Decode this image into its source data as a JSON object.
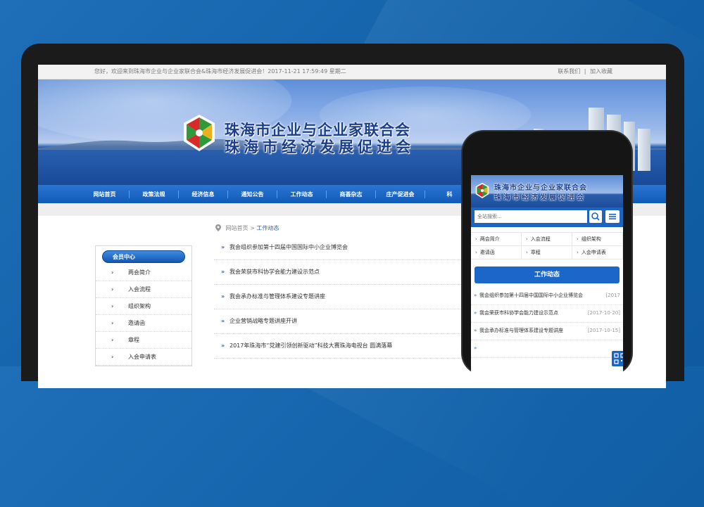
{
  "topbar": {
    "welcome": "您好，欢迎来到珠海市企业与企业家联合会&珠海市经济发展促进会！2017-11-21 17:59:49 星期二",
    "contact": "联系我们",
    "sep": "|",
    "favorite": "加入收藏"
  },
  "banner": {
    "title_line1": "珠海市企业与企业家联合会",
    "title_line2": "珠海市经济发展促进会"
  },
  "nav": [
    "网站首页",
    "政策法规",
    "经济信息",
    "通知公告",
    "工作动态",
    "商荟杂志",
    "庄产促进会",
    "科"
  ],
  "breadcrumb": {
    "home": "网站首页",
    "arrow": " > ",
    "current": "工作动态"
  },
  "sidebar": {
    "head": "会员中心",
    "items": [
      "两会简介",
      "入会流程",
      "组织架构",
      "邀请函",
      "章程",
      "入会申请表"
    ]
  },
  "news": [
    "我会组织参加第十四届中国国际中小企业博览会",
    "我会荣获市科协学会能力建设示范点",
    "我会承办标准与管理体系建设专题讲座",
    "企业营销战略专题讲座开讲",
    "2017年珠海市“党建引领创新驱动”科技大赛珠海电视台 圆满落幕"
  ],
  "phone": {
    "title_line1": "珠海市企业与企业家联合会",
    "title_line2": "珠海市经济发展促进会",
    "search_placeholder": "全站搜索...",
    "grid": [
      "两会简介",
      "入会流程",
      "组织架构",
      "邀请函",
      "章程",
      "入会申请表"
    ],
    "section_title": "工作动态",
    "news": [
      {
        "title": "我会组织参加第十四届中国国际中小企业博览会",
        "date": "[2017"
      },
      {
        "title": "我会荣获市科协学会能力建设示范点",
        "date": "[2017-10-20]"
      },
      {
        "title": "我会承办标准与管理体系建设专题讲座",
        "date": "[2017-10-15]"
      },
      {
        "title": "",
        "date": ""
      }
    ]
  },
  "icons": {
    "chevron": "chevron-right-icon",
    "search": "search-icon",
    "menu": "menu-icon",
    "qr": "qr-code-icon",
    "location": "location-pin-icon"
  },
  "colors": {
    "primary": "#1259b8",
    "accent": "#2a5caa",
    "background": "#1565ad"
  }
}
